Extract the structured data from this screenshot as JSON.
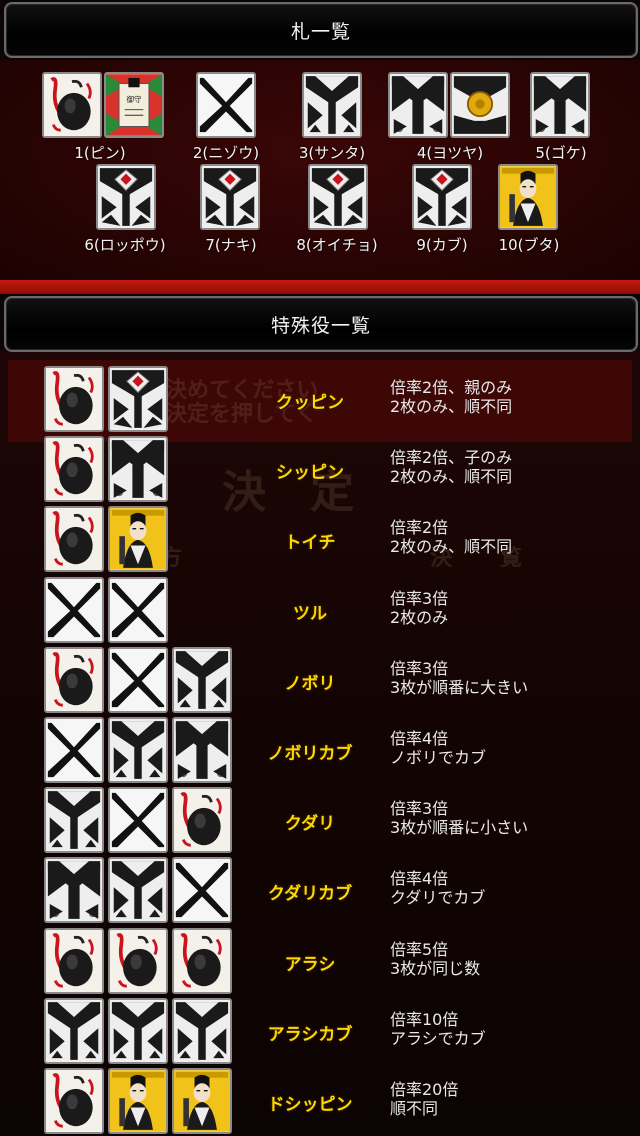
{
  "card_list": {
    "title": "札一覧",
    "cards": [
      {
        "label": "1(ピン)",
        "images": [
          "pin-bag",
          "pin-charm"
        ]
      },
      {
        "label": "2(ニゾウ)",
        "images": [
          "x-white"
        ]
      },
      {
        "label": "3(サンタ)",
        "images": [
          "x-black"
        ]
      },
      {
        "label": "4(ヨツヤ)",
        "images": [
          "x-black-ornate",
          "coin"
        ]
      },
      {
        "label": "5(ゴケ)",
        "images": [
          "x-black-ornate"
        ]
      },
      {
        "label": "6(ロッポウ)",
        "images": [
          "shield"
        ]
      },
      {
        "label": "7(ナキ)",
        "images": [
          "shield"
        ]
      },
      {
        "label": "8(オイチョ)",
        "images": [
          "shield"
        ]
      },
      {
        "label": "9(カブ)",
        "images": [
          "shield"
        ]
      },
      {
        "label": "10(ブタ)",
        "images": [
          "portrait"
        ]
      }
    ]
  },
  "yaku_list": {
    "title": "特殊役一覧",
    "items": [
      {
        "name": "クッピン",
        "cards": [
          "pin-bag",
          "shield"
        ],
        "line1": "倍率2倍、親のみ",
        "line2": "2枚のみ、順不同"
      },
      {
        "name": "シッピン",
        "cards": [
          "pin-bag",
          "x-black-ornate"
        ],
        "line1": "倍率2倍、子のみ",
        "line2": "2枚のみ、順不同"
      },
      {
        "name": "トイチ",
        "cards": [
          "pin-bag",
          "portrait"
        ],
        "line1": "倍率2倍",
        "line2": "2枚のみ、順不同"
      },
      {
        "name": "ツル",
        "cards": [
          "x-white",
          "x-white"
        ],
        "line1": "倍率3倍",
        "line2": "2枚のみ"
      },
      {
        "name": "ノボリ",
        "cards": [
          "pin-bag",
          "x-white",
          "x-black"
        ],
        "line1": "倍率3倍",
        "line2": "3枚が順番に大きい"
      },
      {
        "name": "ノボリカブ",
        "cards": [
          "x-white",
          "x-black",
          "x-black-ornate"
        ],
        "line1": "倍率4倍",
        "line2": "ノボリでカブ"
      },
      {
        "name": "クダリ",
        "cards": [
          "x-black",
          "x-white",
          "pin-bag"
        ],
        "line1": "倍率3倍",
        "line2": "3枚が順番に小さい"
      },
      {
        "name": "クダリカブ",
        "cards": [
          "x-black-ornate",
          "x-black",
          "x-white"
        ],
        "line1": "倍率4倍",
        "line2": "クダリでカブ"
      },
      {
        "name": "アラシ",
        "cards": [
          "pin-bag",
          "pin-bag",
          "pin-bag"
        ],
        "line1": "倍率5倍",
        "line2": "3枚が同じ数"
      },
      {
        "name": "アラシカブ",
        "cards": [
          "x-black",
          "x-black",
          "x-black"
        ],
        "line1": "倍率10倍",
        "line2": "アラシでカブ"
      },
      {
        "name": "ドシッピン",
        "cards": [
          "pin-bag",
          "portrait",
          "portrait"
        ],
        "line1": "倍率20倍",
        "line2": "順不同"
      }
    ]
  },
  "background_overlay": {
    "line_a": "決めてください",
    "line_b": "決定を押してく",
    "big_text": "決　定",
    "small_a": "方",
    "small_b": "決",
    "small_c": "覧"
  }
}
